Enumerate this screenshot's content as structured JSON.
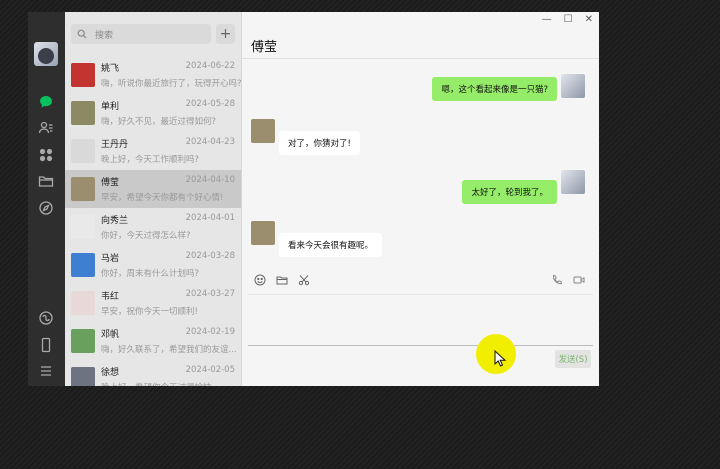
{
  "search": {
    "placeholder": "搜索"
  },
  "chat": {
    "title": "傅莹",
    "send_label": "发送(S)",
    "messages": [
      {
        "from": "me",
        "text": "嗯，这个看起来像是一只猫?"
      },
      {
        "from": "other",
        "text": "对了，你猜对了!"
      },
      {
        "from": "me",
        "text": "太好了，轮到我了。"
      },
      {
        "from": "other",
        "text": "看来今天会很有趣呢。"
      }
    ]
  },
  "contacts": [
    {
      "name": "姚飞",
      "date": "2024-06-22",
      "message": "嗨，听说你最近旅行了，玩得开心吗?",
      "avatar": "#c3332f"
    },
    {
      "name": "单利",
      "date": "2024-05-28",
      "message": "嗨，好久不见，最近过得如何?",
      "avatar": "#8c8a62"
    },
    {
      "name": "王丹丹",
      "date": "2024-04-23",
      "message": "晚上好，今天工作顺利吗?",
      "avatar": "#d9d9d9"
    },
    {
      "name": "傅莹",
      "date": "2024-04-10",
      "message": "早安，希望今天你都有个好心情!",
      "avatar": "#9b8e6f",
      "active": true
    },
    {
      "name": "向秀兰",
      "date": "2024-04-01",
      "message": "你好，今天过得怎么样?",
      "avatar": "#e9e9e9"
    },
    {
      "name": "马岩",
      "date": "2024-03-28",
      "message": "你好，周末有什么计划吗?",
      "avatar": "#3e7fd1"
    },
    {
      "name": "韦红",
      "date": "2024-03-27",
      "message": "早安，祝你今天一切顺利!",
      "avatar": "#e8d8d8"
    },
    {
      "name": "邓帆",
      "date": "2024-02-19",
      "message": "嗨，好久联系了，希望我们的友谊...",
      "avatar": "#6aa05e"
    },
    {
      "name": "徐想",
      "date": "2024-02-05",
      "message": "晚上好，希望你今天过得愉快...",
      "avatar": "#6d7380"
    }
  ],
  "colors": {
    "accent": "#95ec69",
    "sidebar": "#2e2e2e",
    "nav_active": "#07c160"
  },
  "icons": [
    "chat-icon",
    "contacts-icon",
    "apps-icon",
    "folder-icon",
    "compass-icon",
    "mini-program-icon",
    "phone-icon",
    "menu-icon"
  ]
}
